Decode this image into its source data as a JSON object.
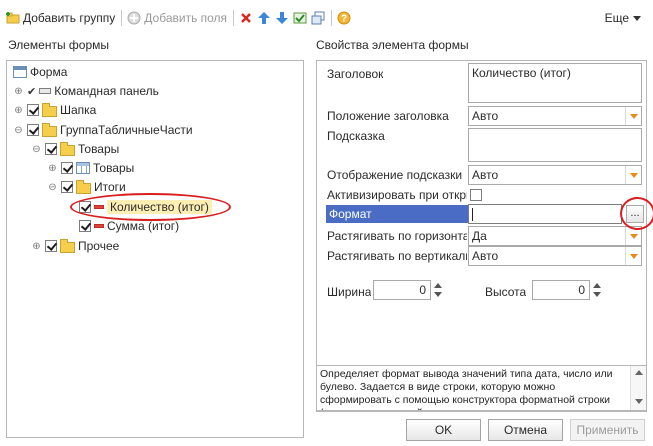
{
  "toolbar": {
    "add_group": "Добавить группу",
    "add_fields": "Добавить поля",
    "more": "Еще"
  },
  "left": {
    "title": "Элементы формы",
    "tree": [
      {
        "label": "Форма"
      },
      {
        "label": "Командная панель"
      },
      {
        "label": "Шапка"
      },
      {
        "label": "ГруппаТабличныеЧасти"
      },
      {
        "label": "Товары"
      },
      {
        "label": "Товары"
      },
      {
        "label": "Итоги"
      },
      {
        "label": "Количество (итог)"
      },
      {
        "label": "Сумма (итог)"
      },
      {
        "label": "Прочее"
      }
    ]
  },
  "right": {
    "title": "Свойства элемента формы",
    "props": {
      "title_label": "Заголовок",
      "title_value": "Количество (итог)",
      "title_pos_label": "Положение заголовка",
      "title_pos_value": "Авто",
      "hint_label": "Подсказка",
      "hint_value": "",
      "hint_display_label": "Отображение подсказки",
      "hint_display_value": "Авто",
      "activate_label": "Активизировать при откры",
      "format_label": "Формат",
      "format_value": "",
      "browse_label": "...",
      "stretch_h_label": "Растягивать по горизонтал",
      "stretch_h_value": "Да",
      "stretch_v_label": "Растягивать по вертикали",
      "stretch_v_value": "Авто",
      "width_label": "Ширина",
      "width_value": "0",
      "height_label": "Высота",
      "height_value": "0"
    },
    "description": "Определяет формат вывода значений типа дата, число или булево. Задается в виде строки, которую можно сформировать с помощью конструктора форматной строки (вызывается кнопкой"
  },
  "buttons": {
    "ok": "OK",
    "cancel": "Отмена",
    "apply": "Применить"
  },
  "colors": {
    "highlight": "#4a6cc5",
    "annotation": "#d81f1f",
    "accent_arrow": "#ec8a18"
  }
}
